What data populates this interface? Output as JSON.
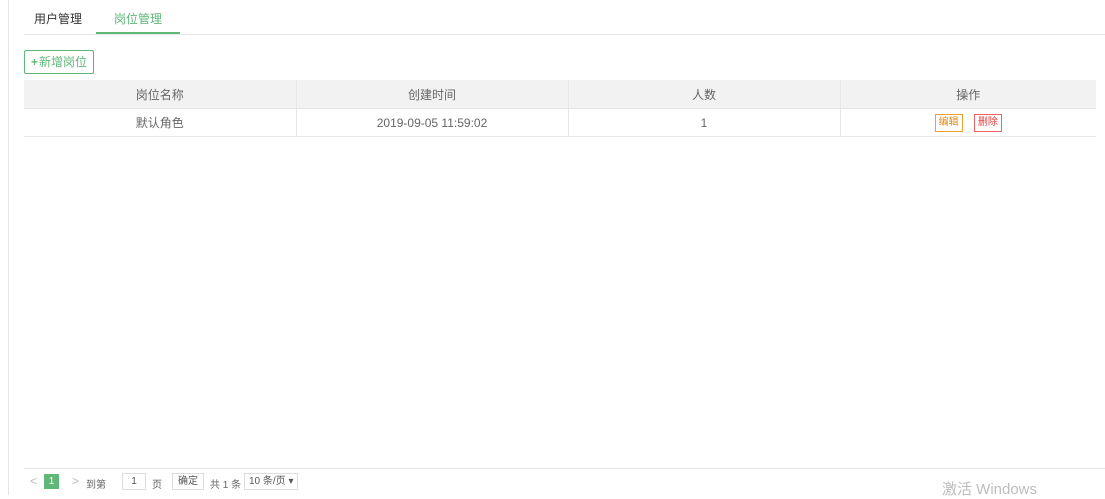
{
  "tabs": [
    {
      "label": "用户管理",
      "active": false
    },
    {
      "label": "岗位管理",
      "active": true
    }
  ],
  "toolbar": {
    "add_icon": "+",
    "add_label": "新增岗位"
  },
  "table": {
    "columns": [
      "岗位名称",
      "创建时间",
      "人数",
      "操作"
    ],
    "rows": [
      {
        "name": "默认角色",
        "created": "2019-09-05 11:59:02",
        "count": "1",
        "edit": "编辑",
        "delete": "删除"
      }
    ]
  },
  "pagination": {
    "prev": "<",
    "current_page": "1",
    "next": ">",
    "goto_label": "到第",
    "goto_value": "1",
    "page_unit": "页",
    "confirm": "确定",
    "total": "共 1 条",
    "page_size": "10 条/页 ▾"
  },
  "watermark": "激活 Windows",
  "colors": {
    "accent": "#5fb878",
    "edit": "#f0a030",
    "delete": "#f06060"
  }
}
